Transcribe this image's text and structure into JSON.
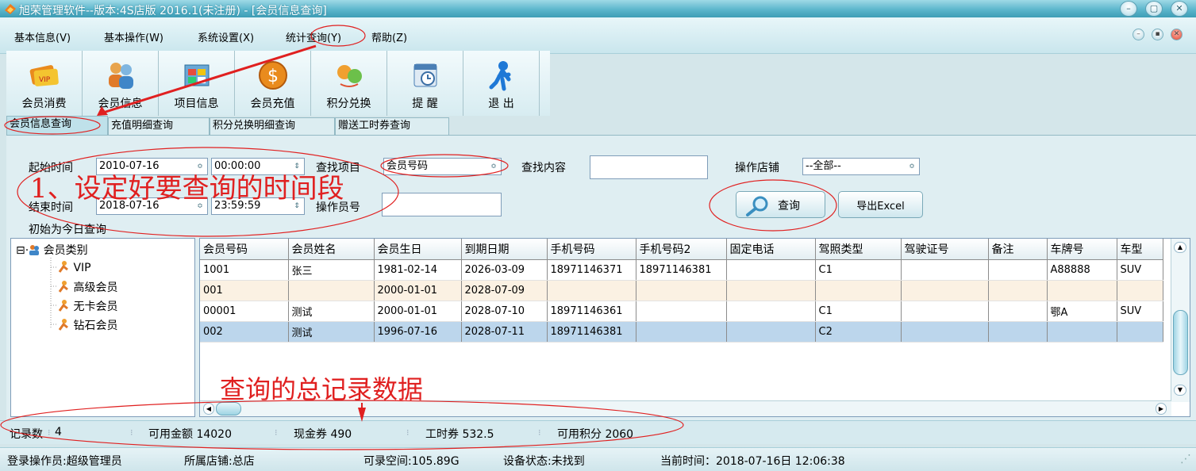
{
  "window": {
    "title": "旭荣管理软件--版本:4S店版 2016.1(未注册) - [会员信息查询]"
  },
  "menu": [
    "基本信息(V)",
    "基本操作(W)",
    "系统设置(X)",
    "统计查询(Y)",
    "帮助(Z)"
  ],
  "toolbar": [
    {
      "label": "会员消费",
      "icon": "vip-card-icon"
    },
    {
      "label": "会员信息",
      "icon": "members-icon"
    },
    {
      "label": "项目信息",
      "icon": "project-icon"
    },
    {
      "label": "会员充值",
      "icon": "recharge-coin-icon"
    },
    {
      "label": "积分兑换",
      "icon": "points-exchange-icon"
    },
    {
      "label": "提 醒",
      "icon": "reminder-icon"
    },
    {
      "label": "退 出",
      "icon": "exit-icon"
    }
  ],
  "tabs": [
    "会员信息查询",
    "充值明细查询",
    "积分兑换明细查询",
    "赠送工时券查询"
  ],
  "filters": {
    "start_label": "起始时间",
    "start_date": "2010-07-16",
    "start_time": "00:00:00",
    "end_label": "结束时间",
    "end_date": "2018-07-16",
    "end_time": "23:59:59",
    "item_label": "查找项目",
    "item_value": "会员号码",
    "operator_label": "操作员号",
    "operator_value": "",
    "content_label": "查找内容",
    "content_value": "",
    "store_label": "操作店铺",
    "store_value": "--全部--",
    "default_note": "初始为今日查询"
  },
  "buttons": {
    "query": "查询",
    "export": "导出Excel"
  },
  "tree": {
    "root": "会员类别",
    "children": [
      "VIP",
      "高级会员",
      "无卡会员",
      "钻石会员"
    ]
  },
  "table": {
    "columns": [
      "会员号码",
      "会员姓名",
      "会员生日",
      "到期日期",
      "手机号码",
      "手机号码2",
      "固定电话",
      "驾照类型",
      "驾驶证号",
      "备注",
      "车牌号",
      "车型"
    ],
    "rows": [
      [
        "1001",
        "张三",
        "1981-02-14",
        "2026-03-09",
        "18971146371",
        "18971146381",
        "",
        "C1",
        "",
        "",
        "A88888",
        "SUV"
      ],
      [
        "001",
        "",
        "2000-01-01",
        "2028-07-09",
        "",
        "",
        "",
        "",
        "",
        "",
        "",
        ""
      ],
      [
        "00001",
        "测试",
        "2000-01-01",
        "2028-07-10",
        "18971146361",
        "",
        "",
        "C1",
        "",
        "",
        "鄂A",
        "SUV"
      ],
      [
        "002",
        "测试",
        "1996-07-16",
        "2028-07-11",
        "18971146381",
        "",
        "",
        "C2",
        "",
        "",
        "",
        ""
      ]
    ]
  },
  "summary": {
    "count_label": "记录数",
    "count": "4",
    "balance": "可用金额 14020",
    "cash": "现金券 490",
    "hours": "工时券 532.5",
    "points": "可用积分 2060"
  },
  "status": {
    "operator": "登录操作员:超级管理员",
    "store": "所属店铺:总店",
    "disk": "可录空间:105.89G",
    "device": "设备状态:未找到",
    "time": "当前时间：2018-07-16日 12:06:38"
  },
  "annotations": {
    "time_range": "1、设定好要查询的时间段",
    "totals": "查询的总记录数据"
  },
  "colors": {
    "title_bar": "#5cb6cc",
    "annotation": "#e02020",
    "selected_row": "#bcd6ec"
  }
}
